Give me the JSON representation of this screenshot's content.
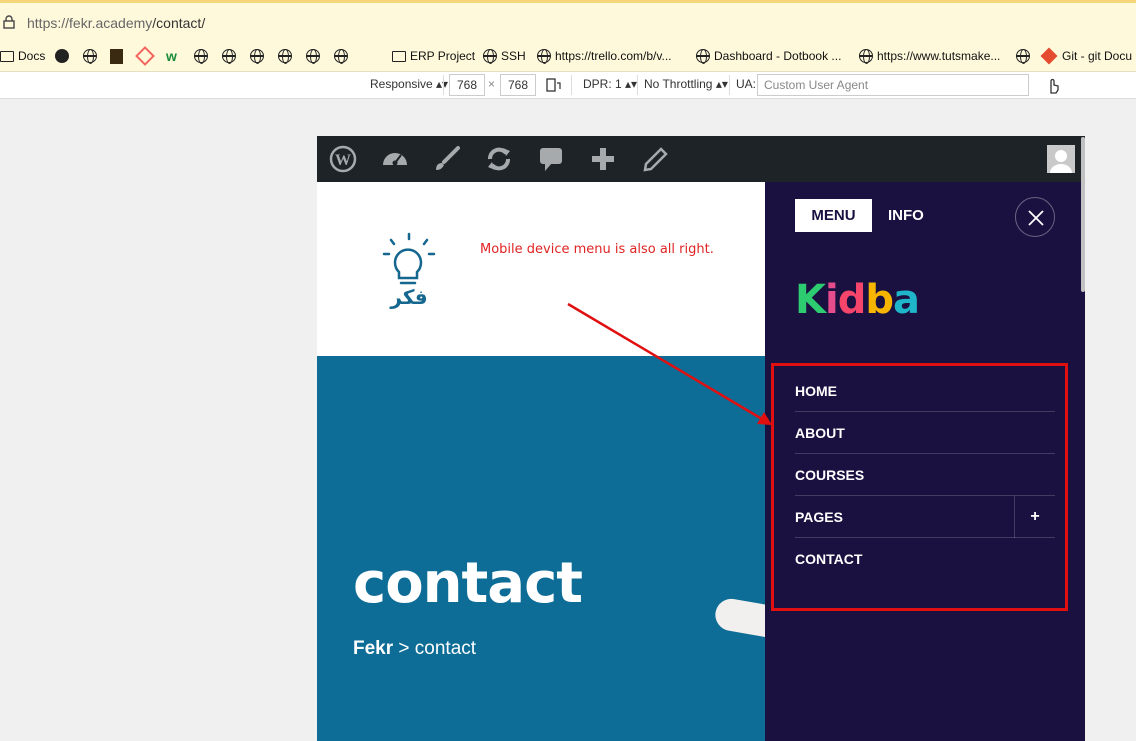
{
  "browser": {
    "url_host": "https://fekr.academy",
    "url_path": "/contact/",
    "bookmarks": [
      {
        "icon": "folder-icon",
        "label": "Docs"
      },
      {
        "icon": "github-icon",
        "label": ""
      },
      {
        "icon": "globe-icon",
        "label": ""
      },
      {
        "icon": "book-icon",
        "label": ""
      },
      {
        "icon": "laravel-icon",
        "label": ""
      },
      {
        "icon": "w-icon",
        "label": ""
      },
      {
        "icon": "globe-icon",
        "label": ""
      },
      {
        "icon": "globe-icon",
        "label": ""
      },
      {
        "icon": "globe-icon",
        "label": ""
      },
      {
        "icon": "globe-icon",
        "label": ""
      },
      {
        "icon": "globe-icon",
        "label": ""
      },
      {
        "icon": "globe-icon",
        "label": ""
      },
      {
        "icon": "folder-icon",
        "label": "ERP Project"
      },
      {
        "icon": "globe-icon",
        "label": "SSH"
      },
      {
        "icon": "globe-icon",
        "label": "https://trello.com/b/v..."
      },
      {
        "icon": "globe-icon",
        "label": "Dashboard - Dotbook ..."
      },
      {
        "icon": "globe-icon",
        "label": "https://www.tutsmake..."
      },
      {
        "icon": "globe-icon",
        "label": ""
      },
      {
        "icon": "git-icon",
        "label": "Git - git Docu"
      }
    ]
  },
  "devtools": {
    "device": "Responsive",
    "width": "768",
    "height": "768",
    "times": "×",
    "dpr": "DPR: 1",
    "throttling": "No Throttling",
    "ua_label": "UA:",
    "ua_placeholder": "Custom User Agent"
  },
  "site": {
    "note": "Mobile device menu is also all right.",
    "logo_text": "فكر",
    "hero_title": "contact",
    "crumb_home": "Fekr",
    "crumb_sep": " > ",
    "crumb_current": "contact"
  },
  "mobile_menu": {
    "tab_menu": "MENU",
    "tab_info": "INFO",
    "brand_letters": [
      {
        "ch": "K",
        "color": "#2ecc71"
      },
      {
        "ch": "i",
        "color": "#e74c8c"
      },
      {
        "ch": "d",
        "color": "#f5456a"
      },
      {
        "ch": "b",
        "color": "#f7b500"
      },
      {
        "ch": "a",
        "color": "#1fb6c9"
      }
    ],
    "items": [
      "HOME",
      "ABOUT",
      "COURSES",
      "PAGES",
      "CONTACT"
    ],
    "pages_toggle": "+"
  },
  "colors": {
    "annotation": "#e02424",
    "hero": "#0e6d96",
    "sidebar": "#1a1140"
  }
}
